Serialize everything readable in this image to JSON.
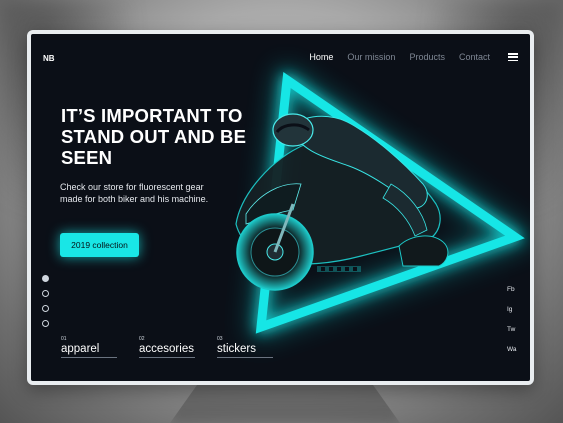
{
  "brand": {
    "logo": "NB"
  },
  "nav": {
    "items": [
      {
        "label": "Home",
        "active": true
      },
      {
        "label": "Our mission",
        "active": false
      },
      {
        "label": "Products",
        "active": false
      },
      {
        "label": "Contact",
        "active": false
      }
    ],
    "menu_icon": "hamburger-menu-icon"
  },
  "hero": {
    "headline": "IT’S IMPORTANT TO STAND OUT AND BE SEEN",
    "subtext": "Check our store for fluorescent gear made for both biker and his machine.",
    "cta_label": "2019 collection"
  },
  "slider": {
    "count": 4,
    "active_index": 0
  },
  "categories": [
    {
      "num": "01",
      "label": "apparel"
    },
    {
      "num": "02",
      "label": "accesories"
    },
    {
      "num": "03",
      "label": "stickers"
    }
  ],
  "social": [
    "Fb",
    "Ig",
    "Tw",
    "Wa"
  ],
  "colors": {
    "accent": "#19e6e6",
    "background": "#0b0f17",
    "frame": "#e9edf0"
  },
  "hero_image": {
    "icon": "motorcycle-rider-illustration",
    "shape": "neon-triangle"
  }
}
